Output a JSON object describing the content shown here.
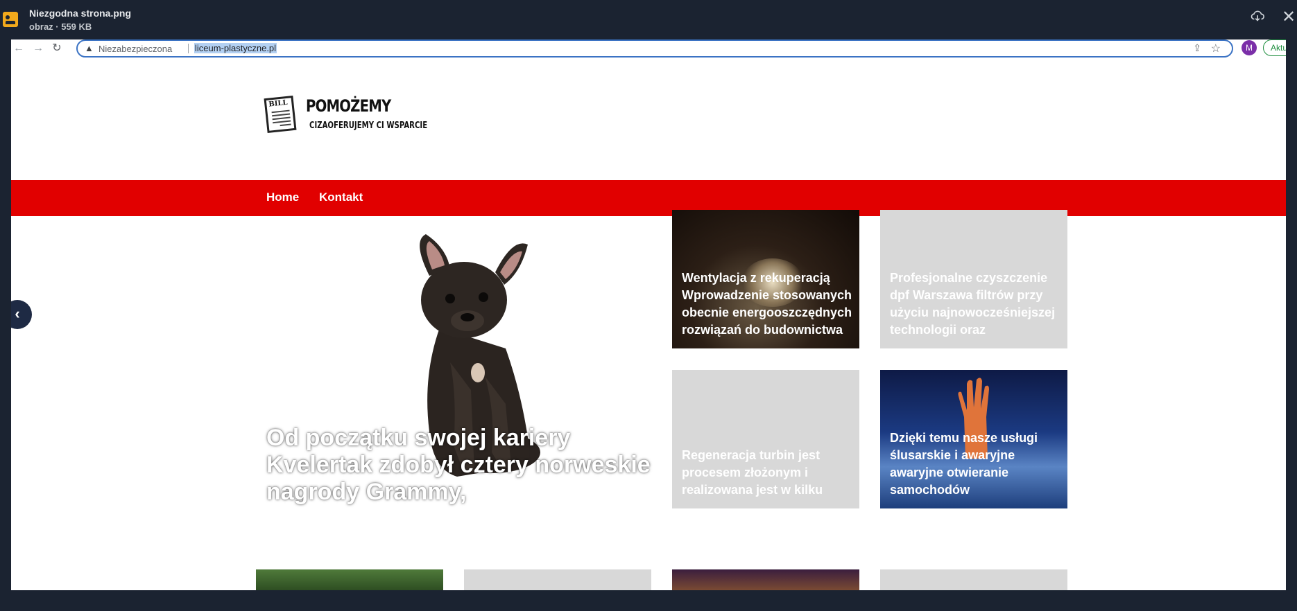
{
  "viewer": {
    "file_name": "Niezgodna strona.png",
    "file_meta": "obraz · 559 KB",
    "download_icon": "cloud-download-icon",
    "close_icon": "close-icon"
  },
  "browser": {
    "insecure_label": "Niezabezpieczona",
    "url": "liceum-plastyczne.pl",
    "avatar_letter": "M",
    "update_label": "Aktu"
  },
  "site": {
    "logo_bill": "BILL",
    "logo_title": "POMOŻEMY",
    "logo_tagline": "CIZAOFERUJEMY CI WSPARCIE",
    "nav": [
      "Home",
      "Kontakt"
    ],
    "hero_title": "Od początku swojej kariery Kvelertak zdobył cztery norweskie nagrody Grammy,",
    "tiles": [
      "Wentylacja z rekuperacją Wprowadzenie stosowanych obecnie energooszczędnych rozwiązań do budownictwa",
      "Profesjonalne czyszczenie dpf Warszawa filtrów przy użyciu najnowocześniejszej technologii oraz",
      "Regeneracja turbin jest procesem złożonym i realizowana jest w kilku",
      "Dzięki temu nasze usługi ślusarskie i awaryjne awaryjne otwieranie samochodów"
    ],
    "accent_color": "#e10000"
  }
}
